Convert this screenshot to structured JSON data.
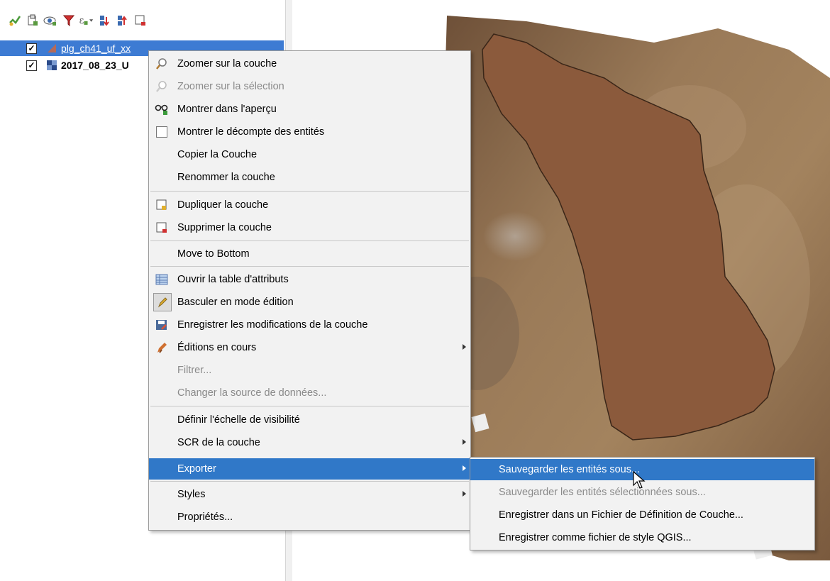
{
  "toolbar": {
    "icons": [
      "style-brush-icon",
      "add-group-icon",
      "visibility-eye-icon",
      "filter-icon",
      "expression-filter-icon",
      "expand-all-icon",
      "collapse-all-icon",
      "remove-layer-icon"
    ]
  },
  "layers": [
    {
      "name": "plg_ch41_uf_xx",
      "checked": "✓"
    },
    {
      "name": "2017_08_23_U",
      "checked": "✓"
    }
  ],
  "context_menu": {
    "zoom_layer": "Zoomer sur la couche",
    "zoom_selection": "Zoomer sur la sélection",
    "show_overview": "Montrer dans l'aperçu",
    "show_feature_count": "Montrer le décompte des entités",
    "copy_layer": "Copier la Couche",
    "rename_layer": "Renommer la couche",
    "duplicate_layer": "Dupliquer la couche",
    "remove_layer": "Supprimer la couche",
    "move_bottom": "Move to Bottom",
    "open_attribute_table": "Ouvrir la table d'attributs",
    "toggle_editing": "Basculer en mode édition",
    "save_edits": "Enregistrer les modifications de la couche",
    "current_edits": "Éditions en cours",
    "filter": "Filtrer...",
    "change_source": "Changer la source de données...",
    "set_scale_visibility": "Définir l'échelle de visibilité",
    "layer_crs": "SCR de la couche",
    "export": "Exporter",
    "styles": "Styles",
    "properties": "Propriétés..."
  },
  "export_submenu": {
    "save_features_as": "Sauvegarder les entités sous...",
    "save_selected_as": "Sauvegarder les entités sélectionnées sous...",
    "save_layer_definition": "Enregistrer dans un Fichier de Définition de Couche...",
    "save_qgis_style": "Enregistrer comme fichier de style QGIS..."
  },
  "colors": {
    "selection": "#3078c8",
    "polygon_fill": "#8b5a3c",
    "background_soil": "#8a6a4a"
  }
}
